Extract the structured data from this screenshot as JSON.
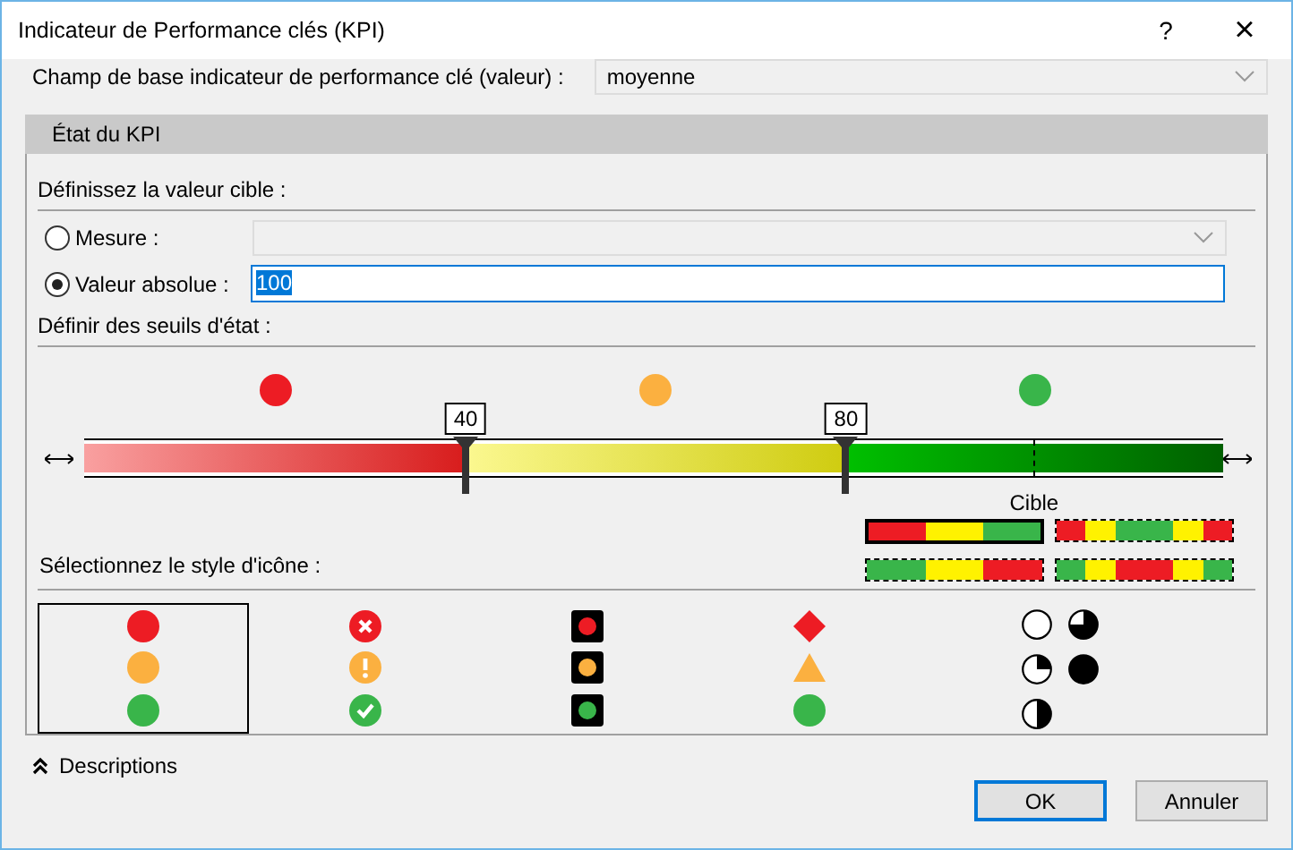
{
  "window": {
    "title": "Indicateur de Performance clés (KPI)",
    "help": "?",
    "close": "×"
  },
  "base_field": {
    "label": "Champ de base indicateur de performance clé (valeur) :",
    "value": "moyenne"
  },
  "section": {
    "title": "État du KPI"
  },
  "target": {
    "heading": "Définissez la valeur cible :",
    "options": [
      {
        "label": "Mesure :",
        "selected": false,
        "kind": "dropdown"
      },
      {
        "label": "Valeur absolue :",
        "selected": true,
        "kind": "text",
        "value": "100"
      }
    ]
  },
  "thresholds": {
    "heading": "Définir des seuils d'état :",
    "states": [
      {
        "color": "#ed1c24"
      },
      {
        "color": "#fbb040"
      },
      {
        "color": "#39b54a"
      }
    ],
    "markers": [
      {
        "label": "40",
        "level": 0.335
      },
      {
        "label": "80",
        "level": 0.669
      }
    ],
    "target_marker": {
      "label": "Cible",
      "level": 0.834
    }
  },
  "icon_style": {
    "heading": "Sélectionnez le style d'icône :",
    "bands": [
      {
        "selected": true,
        "segments": [
          {
            "color": "#ed1c24"
          },
          {
            "color": "#fff200"
          },
          {
            "color": "#39b54a"
          }
        ]
      },
      {
        "selected": false,
        "segments": [
          {
            "color": "#ed1c24"
          },
          {
            "color": "#fff200"
          },
          {
            "color": "#39b54a"
          },
          {
            "color": "#39b54a"
          },
          {
            "color": "#fff200"
          },
          {
            "color": "#ed1c24"
          }
        ]
      },
      {
        "selected": false,
        "segments": [
          {
            "color": "#39b54a"
          },
          {
            "color": "#fff200"
          },
          {
            "color": "#ed1c24"
          }
        ]
      },
      {
        "selected": false,
        "segments": [
          {
            "color": "#39b54a"
          },
          {
            "color": "#fff200"
          },
          {
            "color": "#ed1c24"
          },
          {
            "color": "#ed1c24"
          },
          {
            "color": "#fff200"
          },
          {
            "color": "#39b54a"
          }
        ]
      }
    ],
    "sets": [
      {
        "kind": "circles",
        "selected": true
      },
      {
        "kind": "symbols",
        "selected": false
      },
      {
        "kind": "traffic-lights",
        "selected": false
      },
      {
        "kind": "shapes",
        "selected": false
      },
      {
        "kind": "quarters",
        "selected": false
      }
    ]
  },
  "descriptions": {
    "label": "Descriptions"
  },
  "buttons": [
    {
      "label": "OK",
      "default": true
    },
    {
      "label": "Annuler",
      "default": false
    }
  ]
}
